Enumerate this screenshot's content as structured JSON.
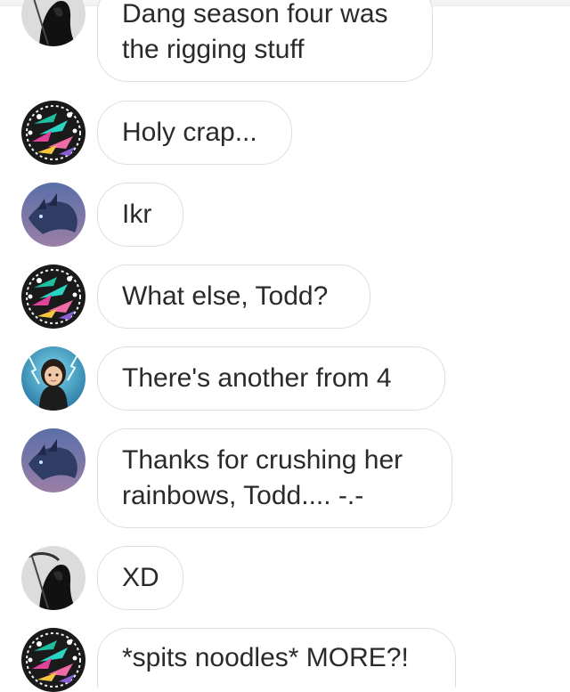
{
  "messages": [
    {
      "avatar": "grim-reaper-avatar",
      "lines": [
        "Dang season four was",
        "the rigging stuff"
      ]
    },
    {
      "avatar": "mandala-avatar",
      "lines": [
        "Holy crap..."
      ]
    },
    {
      "avatar": "dragon-avatar",
      "lines": [
        "Ikr"
      ]
    },
    {
      "avatar": "mandala-avatar",
      "lines": [
        "What else, Todd?"
      ]
    },
    {
      "avatar": "lightning-girl-avatar",
      "lines": [
        "There's another from 4"
      ]
    },
    {
      "avatar": "dragon-avatar",
      "lines": [
        "Thanks for crushing her",
        "rainbows, Todd.... -.-"
      ]
    },
    {
      "avatar": "grim-reaper-avatar",
      "lines": [
        "XD"
      ]
    },
    {
      "avatar": "mandala-avatar",
      "lines": [
        "*spits noodles* MORE?!"
      ]
    }
  ],
  "colors": {
    "bubble_border": "#dedede",
    "text": "#2a2a2a",
    "background": "#ffffff"
  }
}
